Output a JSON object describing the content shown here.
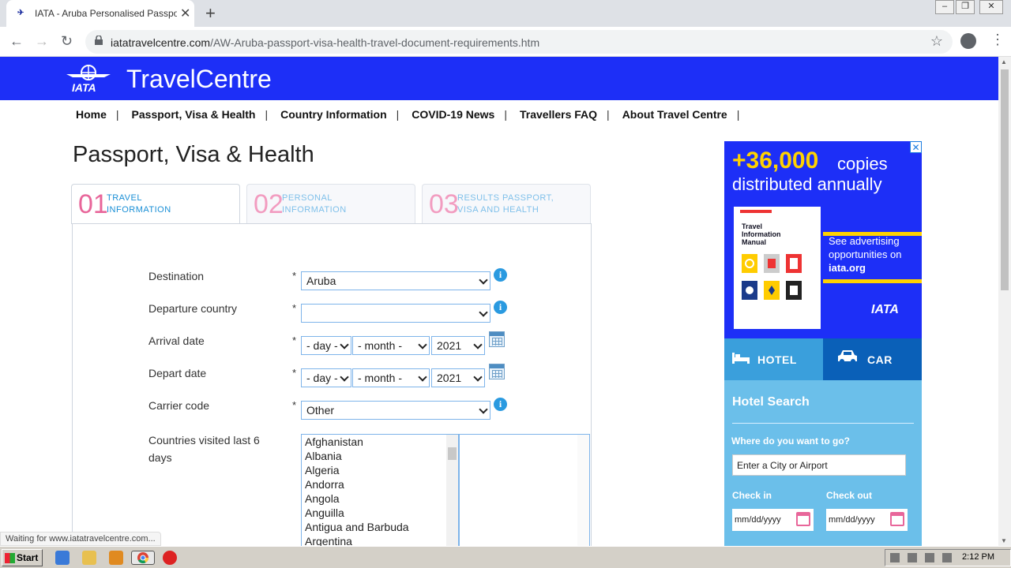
{
  "browser": {
    "tab_title": "IATA - Aruba Personalised Passport, V",
    "url_host": "iatatravelcentre.com",
    "url_path": "/AW-Aruba-passport-visa-health-travel-document-requirements.htm",
    "status": "Waiting for www.iatatravelcentre.com..."
  },
  "header": {
    "brand": "TravelCentre",
    "logo_text": "IATA"
  },
  "nav": [
    "Home",
    "Passport, Visa & Health",
    "Country Information",
    "COVID-19 News",
    "Travellers FAQ",
    "About Travel Centre"
  ],
  "page_title": "Passport, Visa & Health",
  "steps": [
    {
      "num": "01",
      "line1": "TRAVEL",
      "line2": "INFORMATION"
    },
    {
      "num": "02",
      "line1": "PERSONAL",
      "line2": "INFORMATION"
    },
    {
      "num": "03",
      "line1": "RESULTS PASSPORT,",
      "line2": "VISA AND HEALTH"
    }
  ],
  "form": {
    "destination_label": "Destination",
    "destination_value": "Aruba",
    "departure_label": "Departure country",
    "departure_value": "",
    "arrival_label": "Arrival date",
    "depart_label": "Depart date",
    "day_placeholder": "- day -",
    "month_placeholder": "- month -",
    "year_value": "2021",
    "carrier_label": "Carrier code",
    "carrier_value": "Other",
    "countries_label": "Countries visited last 6 days",
    "required_mark": "*",
    "countries": [
      "Afghanistan",
      "Albania",
      "Algeria",
      "Andorra",
      "Angola",
      "Anguilla",
      "Antigua and Barbuda",
      "Argentina"
    ]
  },
  "ad": {
    "big_number": "+36,000",
    "big_word": "copies",
    "line2": "distributed annually",
    "book_title": "Travel Information Manual",
    "side_text_1": "See advertising",
    "side_text_2": "opportunities on",
    "side_link": "iata.org",
    "logo": "IATA",
    "close": "✕"
  },
  "booking": {
    "tab_hotel": "HOTEL",
    "tab_car": "CAR",
    "title": "Hotel Search",
    "question": "Where do you want to go?",
    "city_placeholder": "Enter a City or Airport",
    "checkin_label": "Check in",
    "checkout_label": "Check out",
    "date_placeholder": "mm/dd/yyyy"
  },
  "taskbar": {
    "start": "Start",
    "clock": "2:12 PM"
  },
  "colors": {
    "brand_blue": "#1d2ff7",
    "pink": "#e8669a",
    "sky": "#6bbfea"
  }
}
